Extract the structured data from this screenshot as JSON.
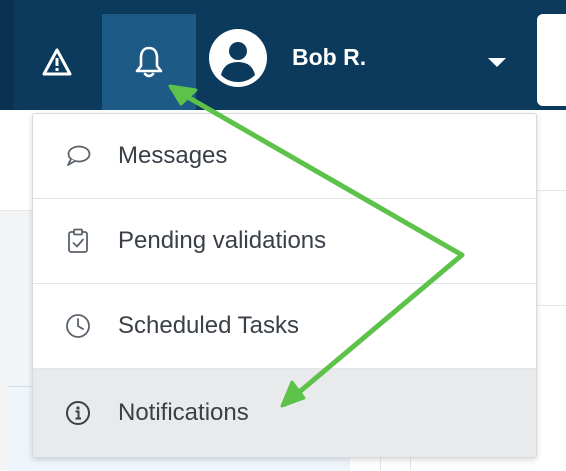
{
  "topbar": {
    "user_name": "Bob R.",
    "icons": [
      "warning-icon",
      "bell-icon",
      "user-avatar-icon",
      "caret-down-icon"
    ]
  },
  "menu": {
    "items": [
      {
        "label": "Messages",
        "icon": "chat-bubble-icon"
      },
      {
        "label": "Pending validations",
        "icon": "clipboard-check-icon"
      },
      {
        "label": "Scheduled Tasks",
        "icon": "clock-icon"
      },
      {
        "label": "Notifications",
        "icon": "info-circle-icon",
        "highlighted": true
      }
    ]
  },
  "colors": {
    "topbar": "#0c3a5c",
    "bell_active": "#1e5a86",
    "annotation_arrow": "#5cc24a",
    "menu_highlight": "#e9eaeb"
  }
}
